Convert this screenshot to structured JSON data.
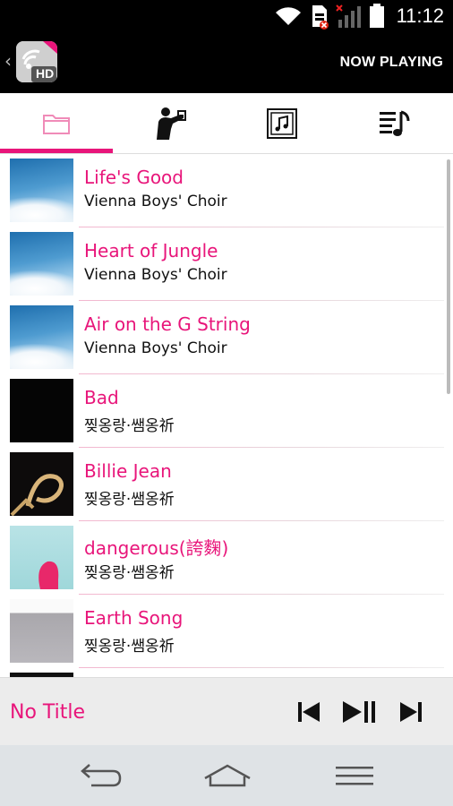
{
  "status_bar": {
    "time": "11:12",
    "icons": [
      "wifi-icon",
      "sim-card-icon",
      "signal-icon",
      "battery-icon"
    ]
  },
  "header": {
    "app_logo_text": "HD",
    "now_playing_label": "NOW PLAYING"
  },
  "tabs": [
    {
      "name": "folder",
      "icon": "folder-icon",
      "active": true
    },
    {
      "name": "artist",
      "icon": "artist-icon",
      "active": false
    },
    {
      "name": "album",
      "icon": "album-icon",
      "active": false
    },
    {
      "name": "playlist",
      "icon": "playlist-icon",
      "active": false
    }
  ],
  "songs": [
    {
      "title": "Life's Good",
      "artist": "Vienna Boys' Choir",
      "art": "sky"
    },
    {
      "title": "Heart of Jungle",
      "artist": "Vienna Boys' Choir",
      "art": "sky"
    },
    {
      "title": "Air on the G String",
      "artist": "Vienna Boys' Choir",
      "art": "sky"
    },
    {
      "title": "Bad",
      "artist": "찢옹랑·쌤옹祈",
      "art": "black"
    },
    {
      "title": "Billie Jean",
      "artist": "찢옹랑·쌤옹祈",
      "art": "billie"
    },
    {
      "title": "dangerous(誇麴)",
      "artist": "찢옹랑·쌤옹祈",
      "art": "dangerous"
    },
    {
      "title": "Earth Song",
      "artist": "찢옹랑·쌤옹祈",
      "art": "earth"
    }
  ],
  "player": {
    "title": "No Title",
    "controls": [
      "previous-icon",
      "play-pause-icon",
      "next-icon"
    ]
  },
  "nav": [
    "back-icon",
    "home-icon",
    "menu-icon"
  ],
  "colors": {
    "accent": "#e8157a",
    "header_bg": "#000000",
    "player_bg": "#ececec",
    "nav_bg": "#dfe3e6"
  }
}
